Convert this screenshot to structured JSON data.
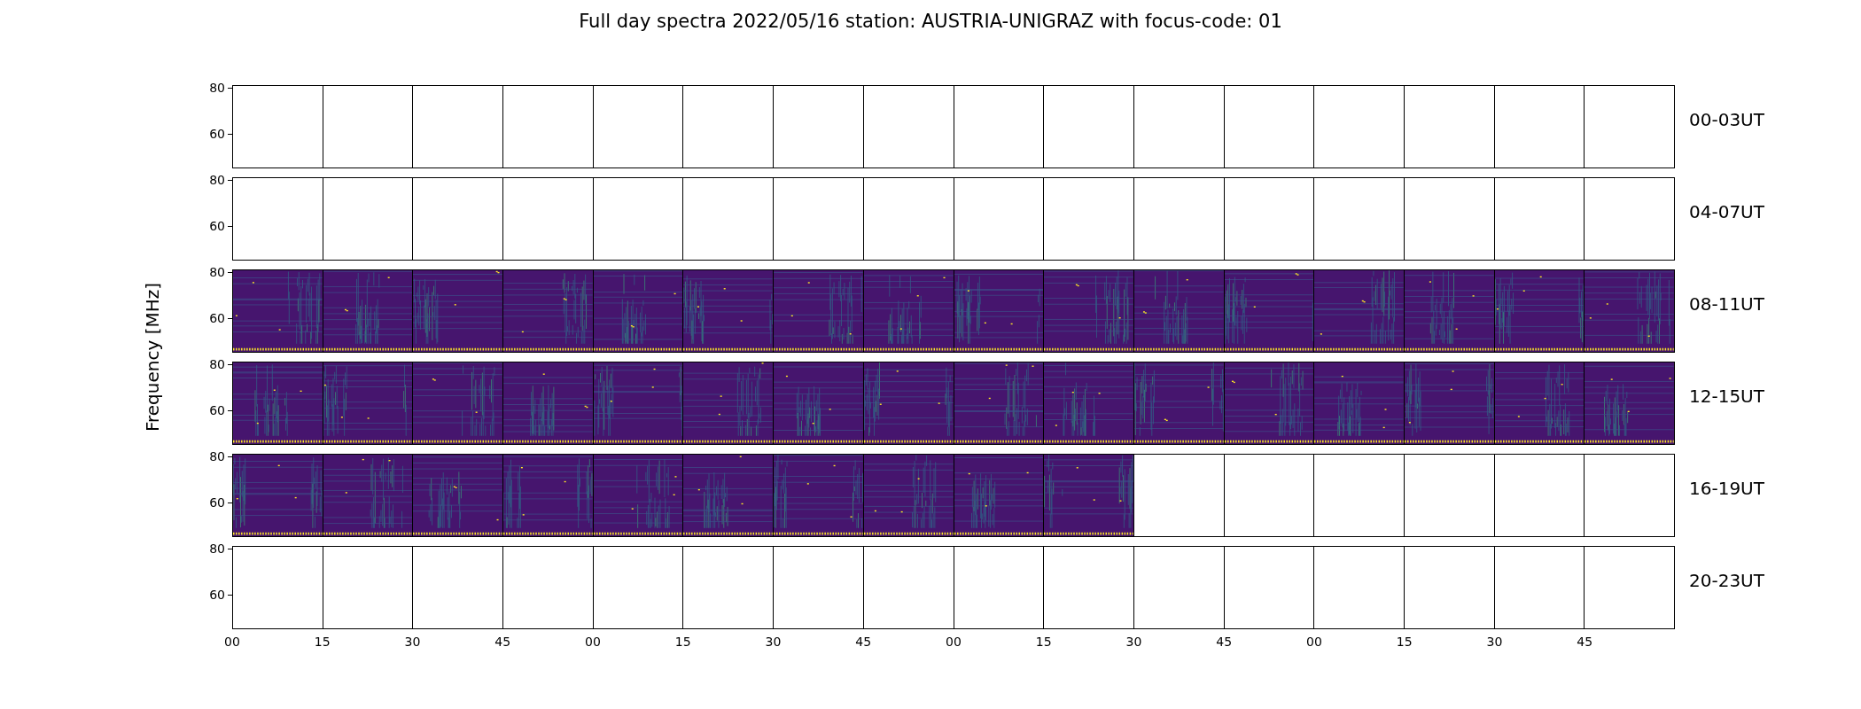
{
  "title": "Full day spectra 2022/05/16 station: AUSTRIA-UNIGRAZ with focus-code: 01",
  "ylabel": "Frequency [MHz]",
  "rows": [
    {
      "label": "00-03UT",
      "yticks": [
        "80",
        "60"
      ],
      "panels": [
        {
          "has_data": false
        },
        {
          "has_data": false
        },
        {
          "has_data": false
        },
        {
          "has_data": false
        },
        {
          "has_data": false
        },
        {
          "has_data": false
        },
        {
          "has_data": false
        },
        {
          "has_data": false
        },
        {
          "has_data": false
        },
        {
          "has_data": false
        },
        {
          "has_data": false
        },
        {
          "has_data": false
        },
        {
          "has_data": false
        },
        {
          "has_data": false
        },
        {
          "has_data": false
        },
        {
          "has_data": false
        }
      ]
    },
    {
      "label": "04-07UT",
      "yticks": [
        "80",
        "60"
      ],
      "panels": [
        {
          "has_data": false
        },
        {
          "has_data": false
        },
        {
          "has_data": false
        },
        {
          "has_data": false
        },
        {
          "has_data": false
        },
        {
          "has_data": false
        },
        {
          "has_data": false
        },
        {
          "has_data": false
        },
        {
          "has_data": false
        },
        {
          "has_data": false
        },
        {
          "has_data": false
        },
        {
          "has_data": false
        },
        {
          "has_data": false
        },
        {
          "has_data": false
        },
        {
          "has_data": false
        },
        {
          "has_data": false
        }
      ]
    },
    {
      "label": "08-11UT",
      "yticks": [
        "80",
        "60"
      ],
      "panels": [
        {
          "has_data": true
        },
        {
          "has_data": true
        },
        {
          "has_data": true
        },
        {
          "has_data": true
        },
        {
          "has_data": true
        },
        {
          "has_data": true
        },
        {
          "has_data": true
        },
        {
          "has_data": true
        },
        {
          "has_data": true
        },
        {
          "has_data": true
        },
        {
          "has_data": true
        },
        {
          "has_data": true
        },
        {
          "has_data": true
        },
        {
          "has_data": true
        },
        {
          "has_data": true
        },
        {
          "has_data": true
        }
      ]
    },
    {
      "label": "12-15UT",
      "yticks": [
        "80",
        "60"
      ],
      "panels": [
        {
          "has_data": true
        },
        {
          "has_data": true
        },
        {
          "has_data": true
        },
        {
          "has_data": true
        },
        {
          "has_data": true
        },
        {
          "has_data": true
        },
        {
          "has_data": true
        },
        {
          "has_data": true
        },
        {
          "has_data": true
        },
        {
          "has_data": true
        },
        {
          "has_data": true
        },
        {
          "has_data": true
        },
        {
          "has_data": true
        },
        {
          "has_data": true
        },
        {
          "has_data": true
        },
        {
          "has_data": true
        }
      ]
    },
    {
      "label": "16-19UT",
      "yticks": [
        "80",
        "60"
      ],
      "panels": [
        {
          "has_data": true
        },
        {
          "has_data": true
        },
        {
          "has_data": true
        },
        {
          "has_data": true
        },
        {
          "has_data": true
        },
        {
          "has_data": true
        },
        {
          "has_data": true
        },
        {
          "has_data": true
        },
        {
          "has_data": true
        },
        {
          "has_data": true
        },
        {
          "has_data": false
        },
        {
          "has_data": false
        },
        {
          "has_data": false
        },
        {
          "has_data": false
        },
        {
          "has_data": false
        },
        {
          "has_data": false
        }
      ]
    },
    {
      "label": "20-23UT",
      "yticks": [
        "80",
        "60"
      ],
      "panels": [
        {
          "has_data": false
        },
        {
          "has_data": false
        },
        {
          "has_data": false
        },
        {
          "has_data": false
        },
        {
          "has_data": false
        },
        {
          "has_data": false
        },
        {
          "has_data": false
        },
        {
          "has_data": false
        },
        {
          "has_data": false
        },
        {
          "has_data": false
        },
        {
          "has_data": false
        },
        {
          "has_data": false
        },
        {
          "has_data": false
        },
        {
          "has_data": false
        },
        {
          "has_data": false
        },
        {
          "has_data": false
        }
      ]
    }
  ],
  "xticks": [
    "00",
    "15",
    "30",
    "45",
    "00",
    "15",
    "30",
    "45",
    "00",
    "15",
    "30",
    "45",
    "00",
    "15",
    "30",
    "45"
  ]
}
